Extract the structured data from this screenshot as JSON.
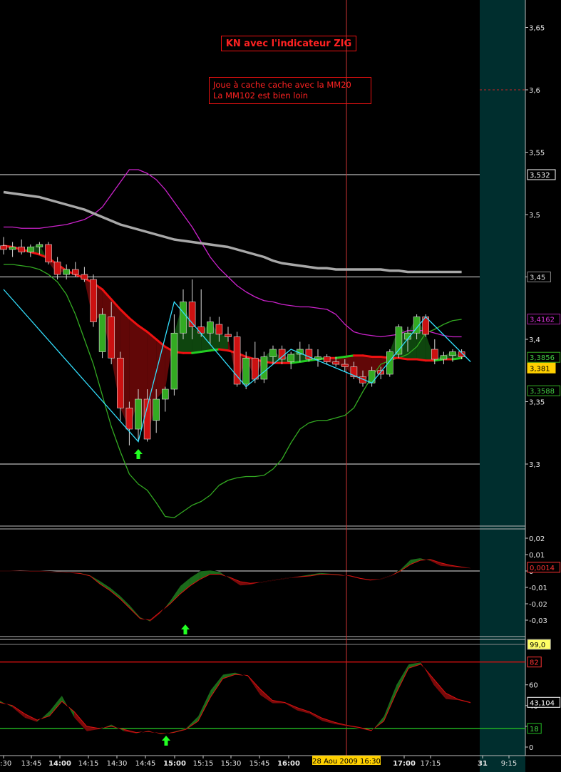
{
  "chart_data": [
    {
      "type": "candlestick",
      "title": "KN avec l'indicateur ZIG",
      "note_lines": [
        "Joue à cache cache avec la MM20",
        "La MM102 est bien loin"
      ],
      "ylim": [
        3.22,
        3.68
      ],
      "yticks": [
        "3,65",
        "3,6",
        "3,55",
        "3,5",
        "3,45",
        "3,4",
        "3,35",
        "3,3"
      ],
      "ytick_values": [
        3.65,
        3.6,
        3.55,
        3.5,
        3.45,
        3.4,
        3.35,
        3.3
      ],
      "xticks": [
        "3:30",
        "13:45",
        "14:00",
        "14:15",
        "14:30",
        "14:45",
        "15:00",
        "15:15",
        "15:30",
        "15:45",
        "16:00",
        "16:15",
        "16:30",
        "16:45",
        "17:00",
        "17:15",
        "31",
        "9:15"
      ],
      "x_highlight": "28 Aou 2009 16:30",
      "hlines": [
        3.532,
        3.45,
        3.3
      ],
      "value_labels": [
        "3,532",
        "3,45",
        "3,4162",
        "3,3856",
        "3,381",
        "3,3588"
      ],
      "last_price": 3.381,
      "candles": [
        {
          "o": 3.475,
          "h": 3.482,
          "l": 3.468,
          "c": 3.472
        },
        {
          "o": 3.472,
          "h": 3.478,
          "l": 3.466,
          "c": 3.474
        },
        {
          "o": 3.474,
          "h": 3.48,
          "l": 3.468,
          "c": 3.47
        },
        {
          "o": 3.47,
          "h": 3.476,
          "l": 3.466,
          "c": 3.474
        },
        {
          "o": 3.474,
          "h": 3.478,
          "l": 3.468,
          "c": 3.476
        },
        {
          "o": 3.476,
          "h": 3.478,
          "l": 3.46,
          "c": 3.462
        },
        {
          "o": 3.462,
          "h": 3.466,
          "l": 3.448,
          "c": 3.452
        },
        {
          "o": 3.452,
          "h": 3.46,
          "l": 3.448,
          "c": 3.456
        },
        {
          "o": 3.456,
          "h": 3.462,
          "l": 3.45,
          "c": 3.452
        },
        {
          "o": 3.452,
          "h": 3.458,
          "l": 3.446,
          "c": 3.448
        },
        {
          "o": 3.448,
          "h": 3.452,
          "l": 3.41,
          "c": 3.414
        },
        {
          "o": 3.39,
          "h": 3.425,
          "l": 3.385,
          "c": 3.42
        },
        {
          "o": 3.418,
          "h": 3.43,
          "l": 3.38,
          "c": 3.385
        },
        {
          "o": 3.385,
          "h": 3.39,
          "l": 3.335,
          "c": 3.345
        },
        {
          "o": 3.345,
          "h": 3.35,
          "l": 3.315,
          "c": 3.328
        },
        {
          "o": 3.328,
          "h": 3.36,
          "l": 3.318,
          "c": 3.352
        },
        {
          "o": 3.352,
          "h": 3.36,
          "l": 3.318,
          "c": 3.32
        },
        {
          "o": 3.335,
          "h": 3.36,
          "l": 3.325,
          "c": 3.352
        },
        {
          "o": 3.352,
          "h": 3.362,
          "l": 3.342,
          "c": 3.36
        },
        {
          "o": 3.36,
          "h": 3.42,
          "l": 3.355,
          "c": 3.405
        },
        {
          "o": 3.405,
          "h": 3.44,
          "l": 3.4,
          "c": 3.43
        },
        {
          "o": 3.43,
          "h": 3.448,
          "l": 3.4,
          "c": 3.41
        },
        {
          "o": 3.41,
          "h": 3.44,
          "l": 3.402,
          "c": 3.405
        },
        {
          "o": 3.405,
          "h": 3.418,
          "l": 3.396,
          "c": 3.414
        },
        {
          "o": 3.412,
          "h": 3.418,
          "l": 3.398,
          "c": 3.404
        },
        {
          "o": 3.404,
          "h": 3.41,
          "l": 3.398,
          "c": 3.402
        },
        {
          "o": 3.402,
          "h": 3.406,
          "l": 3.362,
          "c": 3.364
        },
        {
          "o": 3.364,
          "h": 3.39,
          "l": 3.36,
          "c": 3.385
        },
        {
          "o": 3.385,
          "h": 3.398,
          "l": 3.365,
          "c": 3.368
        },
        {
          "o": 3.368,
          "h": 3.39,
          "l": 3.365,
          "c": 3.386
        },
        {
          "o": 3.386,
          "h": 3.395,
          "l": 3.38,
          "c": 3.392
        },
        {
          "o": 3.392,
          "h": 3.395,
          "l": 3.38,
          "c": 3.384
        },
        {
          "o": 3.382,
          "h": 3.39,
          "l": 3.376,
          "c": 3.388
        },
        {
          "o": 3.388,
          "h": 3.398,
          "l": 3.382,
          "c": 3.392
        },
        {
          "o": 3.392,
          "h": 3.396,
          "l": 3.382,
          "c": 3.384
        },
        {
          "o": 3.384,
          "h": 3.392,
          "l": 3.378,
          "c": 3.386
        },
        {
          "o": 3.386,
          "h": 3.388,
          "l": 3.38,
          "c": 3.382
        },
        {
          "o": 3.382,
          "h": 3.386,
          "l": 3.378,
          "c": 3.38
        },
        {
          "o": 3.38,
          "h": 3.384,
          "l": 3.374,
          "c": 3.378
        },
        {
          "o": 3.378,
          "h": 3.382,
          "l": 3.368,
          "c": 3.37
        },
        {
          "o": 3.37,
          "h": 3.375,
          "l": 3.362,
          "c": 3.365
        },
        {
          "o": 3.365,
          "h": 3.378,
          "l": 3.362,
          "c": 3.375
        },
        {
          "o": 3.375,
          "h": 3.378,
          "l": 3.368,
          "c": 3.372
        },
        {
          "o": 3.372,
          "h": 3.392,
          "l": 3.37,
          "c": 3.39
        },
        {
          "o": 3.388,
          "h": 3.412,
          "l": 3.385,
          "c": 3.41
        },
        {
          "o": 3.4,
          "h": 3.41,
          "l": 3.39,
          "c": 3.405
        },
        {
          "o": 3.405,
          "h": 3.42,
          "l": 3.4,
          "c": 3.418
        },
        {
          "o": 3.418,
          "h": 3.42,
          "l": 3.402,
          "c": 3.404
        },
        {
          "o": 3.392,
          "h": 3.4,
          "l": 3.38,
          "c": 3.384
        },
        {
          "o": 3.384,
          "h": 3.39,
          "l": 3.38,
          "c": 3.387
        },
        {
          "o": 3.387,
          "h": 3.392,
          "l": 3.382,
          "c": 3.39
        },
        {
          "o": 3.39,
          "h": 3.392,
          "l": 3.384,
          "c": 3.386
        }
      ],
      "ma20": [
        3.475,
        3.474,
        3.472,
        3.47,
        3.468,
        3.465,
        3.46,
        3.455,
        3.452,
        3.449,
        3.445,
        3.44,
        3.432,
        3.424,
        3.417,
        3.411,
        3.406,
        3.4,
        3.394,
        3.39,
        3.389,
        3.389,
        3.39,
        3.391,
        3.392,
        3.391,
        3.389,
        3.386,
        3.384,
        3.382,
        3.381,
        3.381,
        3.381,
        3.382,
        3.383,
        3.384,
        3.385,
        3.385,
        3.386,
        3.387,
        3.387,
        3.386,
        3.386,
        3.385,
        3.385,
        3.384,
        3.384,
        3.383,
        3.383,
        3.384,
        3.384,
        3.385
      ],
      "ma102": [
        3.518,
        3.517,
        3.516,
        3.515,
        3.514,
        3.512,
        3.51,
        3.508,
        3.506,
        3.504,
        3.501,
        3.498,
        3.495,
        3.492,
        3.49,
        3.488,
        3.486,
        3.484,
        3.482,
        3.48,
        3.479,
        3.478,
        3.477,
        3.476,
        3.475,
        3.474,
        3.472,
        3.47,
        3.468,
        3.466,
        3.463,
        3.461,
        3.46,
        3.459,
        3.458,
        3.457,
        3.457,
        3.456,
        3.456,
        3.456,
        3.456,
        3.456,
        3.456,
        3.455,
        3.455,
        3.454,
        3.454,
        3.454,
        3.454,
        3.454,
        3.454,
        3.454
      ],
      "bb_upper": [
        3.49,
        3.49,
        3.489,
        3.489,
        3.489,
        3.49,
        3.491,
        3.492,
        3.494,
        3.496,
        3.5,
        3.506,
        3.516,
        3.526,
        3.536,
        3.536,
        3.533,
        3.528,
        3.52,
        3.51,
        3.5,
        3.49,
        3.478,
        3.466,
        3.457,
        3.45,
        3.443,
        3.438,
        3.434,
        3.431,
        3.43,
        3.428,
        3.427,
        3.426,
        3.426,
        3.425,
        3.424,
        3.42,
        3.412,
        3.406,
        3.404,
        3.403,
        3.402,
        3.403,
        3.404,
        3.407,
        3.407,
        3.407,
        3.405,
        3.403,
        3.402,
        3.402
      ],
      "bb_lower": [
        3.46,
        3.46,
        3.459,
        3.458,
        3.456,
        3.452,
        3.446,
        3.436,
        3.42,
        3.4,
        3.38,
        3.355,
        3.33,
        3.31,
        3.292,
        3.284,
        3.279,
        3.269,
        3.258,
        3.257,
        3.262,
        3.267,
        3.27,
        3.275,
        3.283,
        3.287,
        3.289,
        3.29,
        3.29,
        3.291,
        3.296,
        3.304,
        3.317,
        3.328,
        3.333,
        3.335,
        3.335,
        3.337,
        3.339,
        3.345,
        3.358,
        3.37,
        3.38,
        3.383,
        3.385,
        3.388,
        3.394,
        3.405,
        3.408,
        3.412,
        3.415,
        3.416
      ],
      "zigzag": [
        [
          0,
          3.44
        ],
        [
          15,
          3.318
        ],
        [
          19,
          3.43
        ],
        [
          27,
          3.362
        ],
        [
          32,
          3.392
        ],
        [
          41,
          3.365
        ],
        [
          47,
          3.418
        ],
        [
          52,
          3.382
        ]
      ],
      "green_arrow_index": 15
    },
    {
      "type": "line",
      "name": "oscillator",
      "ylim": [
        -0.045,
        0.025
      ],
      "yticks": [
        "0,02",
        "0,01",
        "0",
        "-0,01",
        "-0,02",
        "-0,03"
      ],
      "ytick_values": [
        0.02,
        0.01,
        0,
        -0.01,
        -0.02,
        -0.03
      ],
      "value_label": "0,0014",
      "green_arrow_index": 15,
      "fast": [
        0.0,
        0.0,
        -0.0002,
        0.0,
        0.0,
        -0.0002,
        -0.0005,
        -0.0008,
        -0.001,
        -0.0025,
        -0.006,
        -0.01,
        -0.015,
        -0.021,
        -0.028,
        -0.031,
        -0.026,
        -0.018,
        -0.009,
        -0.004,
        0.0,
        0.0005,
        -0.0005,
        -0.005,
        -0.009,
        -0.0085,
        -0.007,
        -0.006,
        -0.005,
        -0.004,
        -0.003,
        -0.002,
        -0.001,
        -0.0015,
        -0.002,
        -0.0035,
        -0.005,
        -0.006,
        -0.005,
        -0.003,
        0.001,
        0.007,
        0.008,
        0.006,
        0.003,
        0.0025,
        0.002,
        0.0015
      ],
      "slow": [
        0.0,
        0.0,
        -0.0001,
        -0.0001,
        -0.0001,
        -0.0003,
        -0.0006,
        -0.0009,
        -0.0015,
        -0.003,
        -0.008,
        -0.012,
        -0.017,
        -0.023,
        -0.029,
        -0.03,
        -0.025,
        -0.02,
        -0.014,
        -0.009,
        -0.005,
        -0.002,
        -0.002,
        -0.004,
        -0.0065,
        -0.0075,
        -0.007,
        -0.006,
        -0.005,
        -0.004,
        -0.0035,
        -0.003,
        -0.002,
        -0.002,
        -0.0025,
        -0.003,
        -0.0045,
        -0.0055,
        -0.005,
        -0.003,
        0.0,
        0.004,
        0.0065,
        0.007,
        0.005,
        0.0035,
        0.0025,
        0.0015
      ]
    },
    {
      "type": "line",
      "name": "stochastic",
      "ylim": [
        -5,
        107
      ],
      "yticks": [
        "60",
        "40",
        "20",
        "0"
      ],
      "ytick_values": [
        60,
        40,
        20,
        0
      ],
      "hlines": [
        99,
        82,
        18
      ],
      "value_labels": [
        "99,0",
        "82",
        "43,104",
        "18"
      ],
      "green_arrow_index": 15,
      "fast": [
        45,
        38,
        28,
        24,
        35,
        50,
        28,
        15,
        17,
        22,
        15,
        13,
        16,
        12,
        15,
        18,
        30,
        55,
        70,
        72,
        68,
        50,
        42,
        42,
        35,
        32,
        25,
        22,
        20,
        18,
        15,
        30,
        60,
        80,
        82,
        60,
        46,
        45,
        42
      ],
      "slow": [
        43,
        40,
        32,
        26,
        30,
        44,
        34,
        20,
        18,
        20,
        17,
        14,
        15,
        13,
        14,
        17,
        25,
        48,
        66,
        70,
        69,
        56,
        45,
        43,
        38,
        34,
        28,
        24,
        21,
        19,
        16,
        25,
        52,
        76,
        80,
        66,
        52,
        46,
        43
      ]
    }
  ],
  "colors": {
    "background": "#000000",
    "right_panel": "#002e2e",
    "bull": "#33aa22",
    "bear": "#cc1111",
    "ma20": "#ee1111",
    "ma20_up": "#22cc22",
    "ma102": "#a8a8a8",
    "bollinger_upper": "#cc22cc",
    "bollinger_lower": "#33aa22",
    "zigzag": "#33e0ff",
    "arrow": "#22ff22"
  }
}
